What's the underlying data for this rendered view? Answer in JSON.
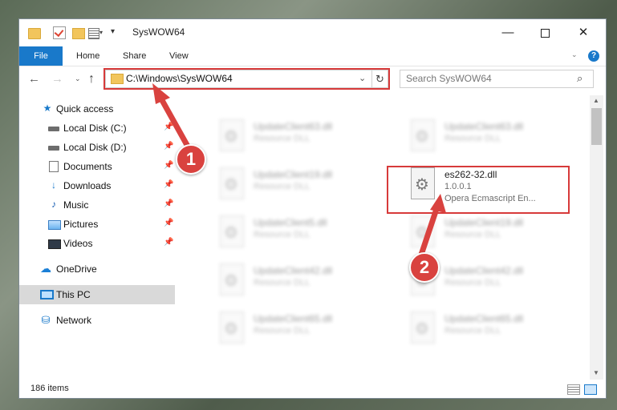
{
  "window": {
    "title": "SysWOW64",
    "controls": {
      "minimize": "—",
      "maximize": "",
      "close": "✕"
    }
  },
  "quick_access_toolbar": {
    "dropdown": "▾",
    "customize": "▾"
  },
  "ribbon": {
    "tabs": [
      {
        "label": "File",
        "active": true
      },
      {
        "label": "Home"
      },
      {
        "label": "Share"
      },
      {
        "label": "View"
      }
    ],
    "expand": "⌄",
    "help": "?"
  },
  "navigation": {
    "back": "←",
    "forward": "→",
    "recent": "⌄",
    "up": "↑",
    "address": "C:\\Windows\\SysWOW64",
    "address_dropdown": "⌄",
    "refresh": "↻",
    "search_placeholder": "Search SysWOW64",
    "search_icon": "⌕"
  },
  "sidebar": {
    "items": [
      {
        "label": "Quick access",
        "icon": "star-icon",
        "glyph": "★",
        "pinned": false
      },
      {
        "label": "Local Disk (C:)",
        "icon": "drive-icon",
        "glyph": "",
        "pinned": true
      },
      {
        "label": "Local Disk (D:)",
        "icon": "drive-icon",
        "glyph": "",
        "pinned": true
      },
      {
        "label": "Documents",
        "icon": "document-icon",
        "glyph": "",
        "pinned": true
      },
      {
        "label": "Downloads",
        "icon": "download-icon",
        "glyph": "↓",
        "pinned": true
      },
      {
        "label": "Music",
        "icon": "music-icon",
        "glyph": "♪",
        "pinned": true
      },
      {
        "label": "Pictures",
        "icon": "pictures-icon",
        "glyph": "",
        "pinned": true
      },
      {
        "label": "Videos",
        "icon": "videos-icon",
        "glyph": "",
        "pinned": true
      },
      {
        "label": "OneDrive",
        "icon": "cloud-icon",
        "glyph": "☁",
        "pinned": false
      },
      {
        "label": "This PC",
        "icon": "computer-icon",
        "glyph": "",
        "pinned": false,
        "selected": true
      },
      {
        "label": "Network",
        "icon": "network-icon",
        "glyph": "⛁",
        "pinned": false
      }
    ],
    "pin_glyph": "📌"
  },
  "files": [
    {
      "name": "UpdateClient63.dll",
      "type": "Resource DLL",
      "blurred": true
    },
    {
      "name": "UpdateClient63.dll",
      "type": "Resource DLL",
      "blurred": true
    },
    {
      "name": "UpdateClient19.dll",
      "type": "Resource DLL",
      "blurred": true
    },
    {
      "name": "es262-32.dll",
      "version": "1.0.0.1",
      "description": "Opera Ecmascript En...",
      "blurred": false,
      "highlighted": true
    },
    {
      "name": "UpdateClient5.dll",
      "type": "Resource DLL",
      "blurred": true
    },
    {
      "name": "UpdateClient19.dll",
      "type": "Resource DLL",
      "blurred": true
    },
    {
      "name": "UpdateClient42.dll",
      "type": "Resource DLL",
      "blurred": true
    },
    {
      "name": "UpdateClient42.dll",
      "type": "Resource DLL",
      "blurred": true
    },
    {
      "name": "UpdateClient65.dll",
      "type": "Resource DLL",
      "blurred": true
    },
    {
      "name": "UpdateClient65.dll",
      "type": "Resource DLL",
      "blurred": true
    }
  ],
  "scrollbar": {
    "up": "▲",
    "down": "▼"
  },
  "status": {
    "item_count": "186 items"
  },
  "annotations": [
    {
      "label": "1",
      "color": "#d9423f"
    },
    {
      "label": "2",
      "color": "#d9423f"
    }
  ],
  "colors": {
    "accent": "#1979ca",
    "highlight": "#d73a3a",
    "callout": "#d9423f"
  }
}
